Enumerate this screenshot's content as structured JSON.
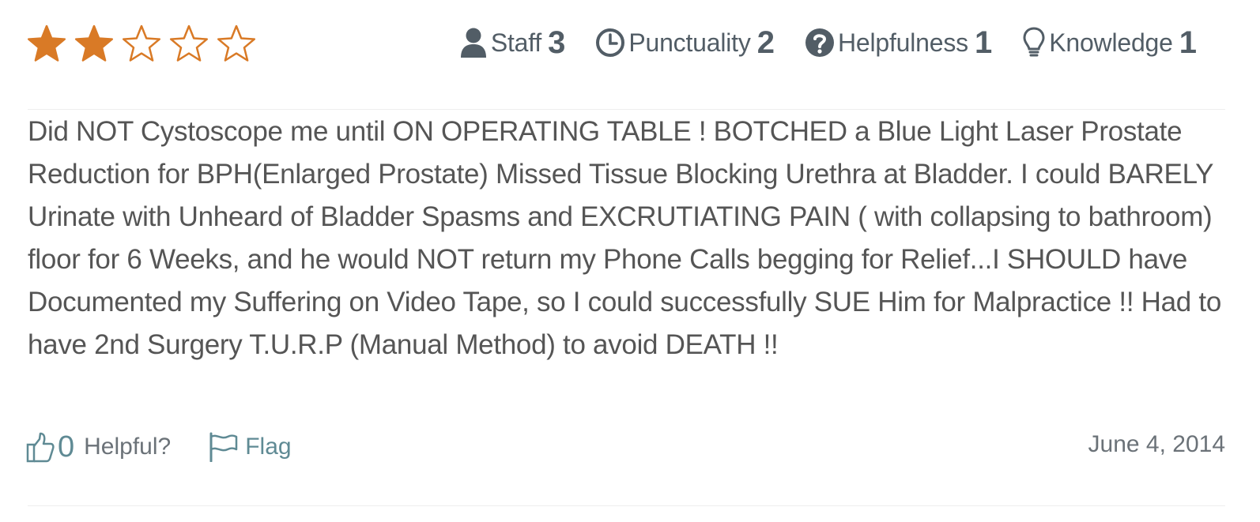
{
  "rating": {
    "stars_total": 5,
    "stars_filled": 2,
    "star_color": "#d97a26"
  },
  "metrics": [
    {
      "icon": "user-icon",
      "label": "Staff",
      "value": "3"
    },
    {
      "icon": "clock-icon",
      "label": "Punctuality",
      "value": "2"
    },
    {
      "icon": "question-circle-icon",
      "label": "Helpfulness",
      "value": "1"
    },
    {
      "icon": "lightbulb-icon",
      "label": "Knowledge",
      "value": "1"
    }
  ],
  "review": {
    "text": "Did NOT Cystoscope me until ON OPERATING TABLE ! BOTCHED a Blue Light Laser Prostate Reduction for BPH(Enlarged Prostate) Missed Tissue Blocking Urethra at Bladder. I could BARELY Urinate with Unheard of Bladder Spasms and EXCRUTIATING PAIN ( with collapsing to bathroom) floor for 6 Weeks, and he would NOT return my Phone Calls begging for Relief...I SHOULD have Documented my Suffering on Video Tape, so I could successfully SUE Him for Malpractice !! Had to have 2nd Surgery T.U.R.P (Manual Method) to avoid DEATH !!",
    "date": "June 4, 2014"
  },
  "actions": {
    "helpful_count": "0",
    "helpful_label": "Helpful?",
    "flag_label": "Flag",
    "link_color": "#5f8a94"
  },
  "colors": {
    "text": "#555555",
    "metric_text": "#525d66"
  }
}
